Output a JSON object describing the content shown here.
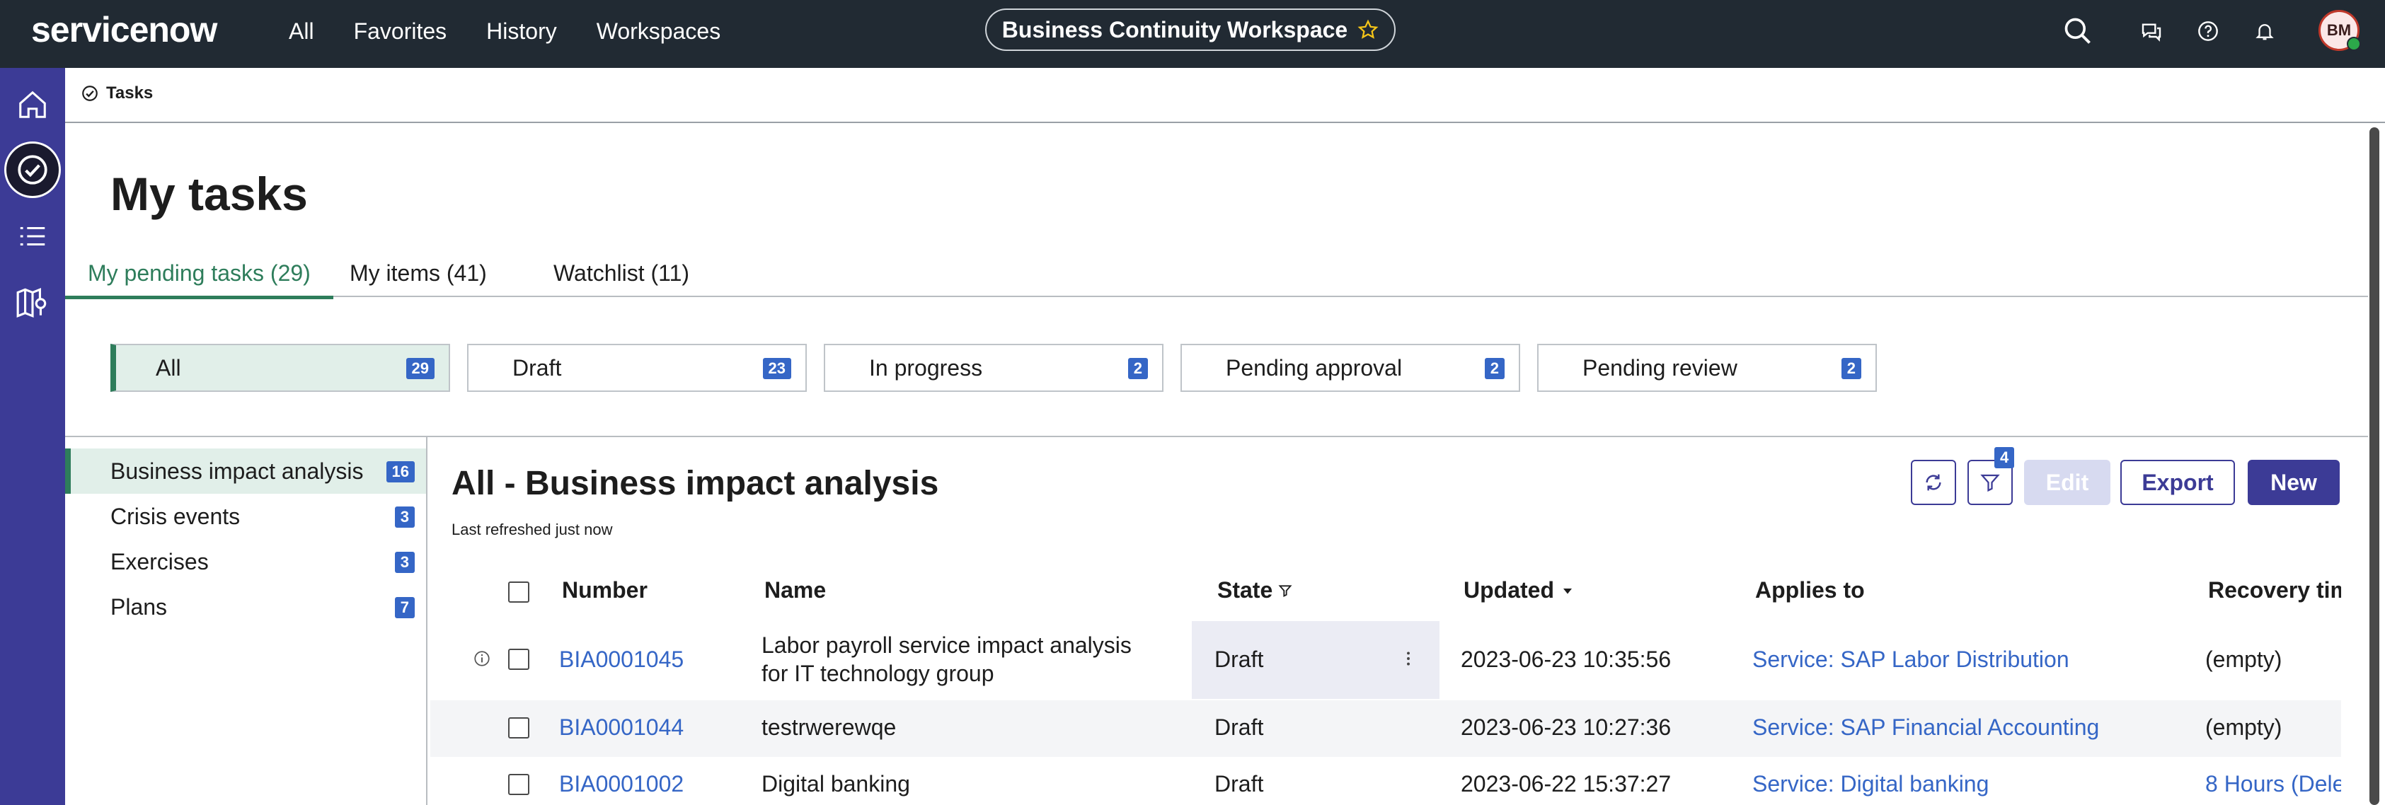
{
  "header": {
    "logo": "servicenow",
    "nav": [
      "All",
      "Favorites",
      "History",
      "Workspaces"
    ],
    "workspace_title": "Business Continuity Workspace",
    "avatar_initials": "BM",
    "icons": [
      "search-icon",
      "chat-icon",
      "help-icon",
      "bell-icon"
    ]
  },
  "rail": {
    "icons": [
      "home-icon",
      "tasks-icon",
      "list-icon",
      "map-icon"
    ]
  },
  "breadcrumb": {
    "label": "Tasks"
  },
  "page": {
    "title": "My tasks"
  },
  "tabs": [
    {
      "label": "My pending tasks (29)"
    },
    {
      "label": "My items (41)"
    },
    {
      "label": "Watchlist (11)"
    }
  ],
  "filters": [
    {
      "label": "All",
      "count": "29"
    },
    {
      "label": "Draft",
      "count": "23"
    },
    {
      "label": "In progress",
      "count": "2"
    },
    {
      "label": "Pending approval",
      "count": "2"
    },
    {
      "label": "Pending review",
      "count": "2"
    }
  ],
  "categories": [
    {
      "label": "Business impact analysis",
      "count": "16"
    },
    {
      "label": "Crisis events",
      "count": "3"
    },
    {
      "label": "Exercises",
      "count": "3"
    },
    {
      "label": "Plans",
      "count": "7"
    }
  ],
  "list": {
    "title": "All - Business impact analysis",
    "subtitle": "Last refreshed just now",
    "filter_count": "4",
    "buttons": {
      "edit": "Edit",
      "export": "Export",
      "new": "New"
    }
  },
  "table": {
    "columns": [
      "Number",
      "Name",
      "State",
      "Updated",
      "Applies to",
      "Recovery tim"
    ],
    "rows": [
      {
        "number": "BIA0001045",
        "name_line1": "Labor payroll service impact analysis",
        "name_line2": "for IT technology group",
        "state": "Draft",
        "updated": "2023-06-23 10:35:56",
        "applies_to": "Service: SAP Labor Distribution",
        "recovery": "(empty)"
      },
      {
        "number": "BIA0001044",
        "name_line1": "testrwerewqe",
        "name_line2": "",
        "state": "Draft",
        "updated": "2023-06-23 10:27:36",
        "applies_to": "Service: SAP Financial Accounting",
        "recovery": "(empty)"
      },
      {
        "number": "BIA0001002",
        "name_line1": "Digital banking",
        "name_line2": "",
        "state": "Draft",
        "updated": "2023-06-22 15:37:27",
        "applies_to": "Service: Digital banking",
        "recovery": "8 Hours (Dele"
      }
    ]
  },
  "colors": {
    "header_bg": "#212a33",
    "rail_bg": "#3c3b96",
    "accent": "#2e7d5b",
    "link": "#3566c6",
    "badge": "#3566c6"
  }
}
